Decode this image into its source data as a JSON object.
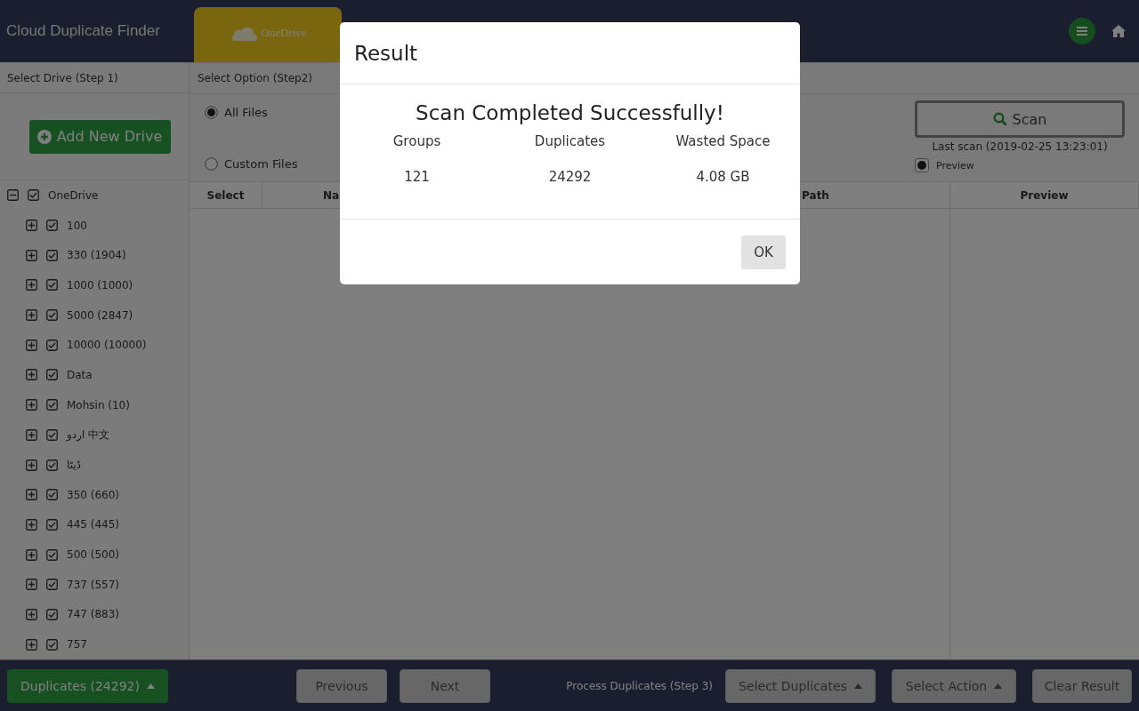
{
  "app": {
    "title": "Cloud Duplicate Finder"
  },
  "drive_tabs": [
    {
      "label": "OneDrive",
      "selected": true
    }
  ],
  "step1": {
    "label": "Select Drive (Step 1)",
    "add_button": "Add New Drive"
  },
  "step2": {
    "label": "Select Option (Step2)",
    "scan_button": "Scan",
    "last_scan": "Last scan (2019-02-25 13:23:01)",
    "preview_option": {
      "label": "Preview",
      "checked": true
    },
    "options": [
      {
        "label": "All Files",
        "selected": true
      },
      {
        "label": "Custom Files",
        "selected": false
      }
    ]
  },
  "tree": [
    {
      "label": "OneDrive",
      "expanded": true,
      "checked": true,
      "children": [
        {
          "label": "100",
          "expanded": false,
          "checked": true
        },
        {
          "label": "330 (1904)",
          "expanded": false,
          "checked": true
        },
        {
          "label": "1000 (1000)",
          "expanded": false,
          "checked": true
        },
        {
          "label": "5000 (2847)",
          "expanded": false,
          "checked": true
        },
        {
          "label": "10000 (10000)",
          "expanded": false,
          "checked": true
        },
        {
          "label": "Data",
          "expanded": false,
          "checked": true
        },
        {
          "label": "Mohsin (10)",
          "expanded": false,
          "checked": true
        },
        {
          "label": "اردو 中文",
          "expanded": false,
          "checked": true
        },
        {
          "label": "ڈیٹا",
          "expanded": false,
          "checked": true
        },
        {
          "label": "350 (660)",
          "expanded": false,
          "checked": true
        },
        {
          "label": "445 (445)",
          "expanded": false,
          "checked": true
        },
        {
          "label": "500 (500)",
          "expanded": false,
          "checked": true
        },
        {
          "label": "737 (557)",
          "expanded": false,
          "checked": true
        },
        {
          "label": "747 (883)",
          "expanded": false,
          "checked": true
        },
        {
          "label": "757",
          "expanded": false,
          "checked": true
        }
      ]
    }
  ],
  "table": {
    "columns": [
      "Select",
      "Na",
      "",
      "Path",
      "Preview"
    ]
  },
  "footer": {
    "duplicates_button": "Duplicates (24292)",
    "previous_button": "Previous",
    "next_button": "Next",
    "step3_label": "Process Duplicates (Step 3)",
    "select_duplicates_button": "Select Duplicates",
    "select_action_button": "Select Action",
    "clear_button": "Clear Result"
  },
  "dialog": {
    "title": "Result",
    "heading": "Scan Completed Successfully!",
    "stats": [
      {
        "label": "Groups",
        "value": "121"
      },
      {
        "label": "Duplicates",
        "value": "24292"
      },
      {
        "label": "Wasted Space",
        "value": "4.08 GB"
      }
    ],
    "ok_button": "OK"
  }
}
